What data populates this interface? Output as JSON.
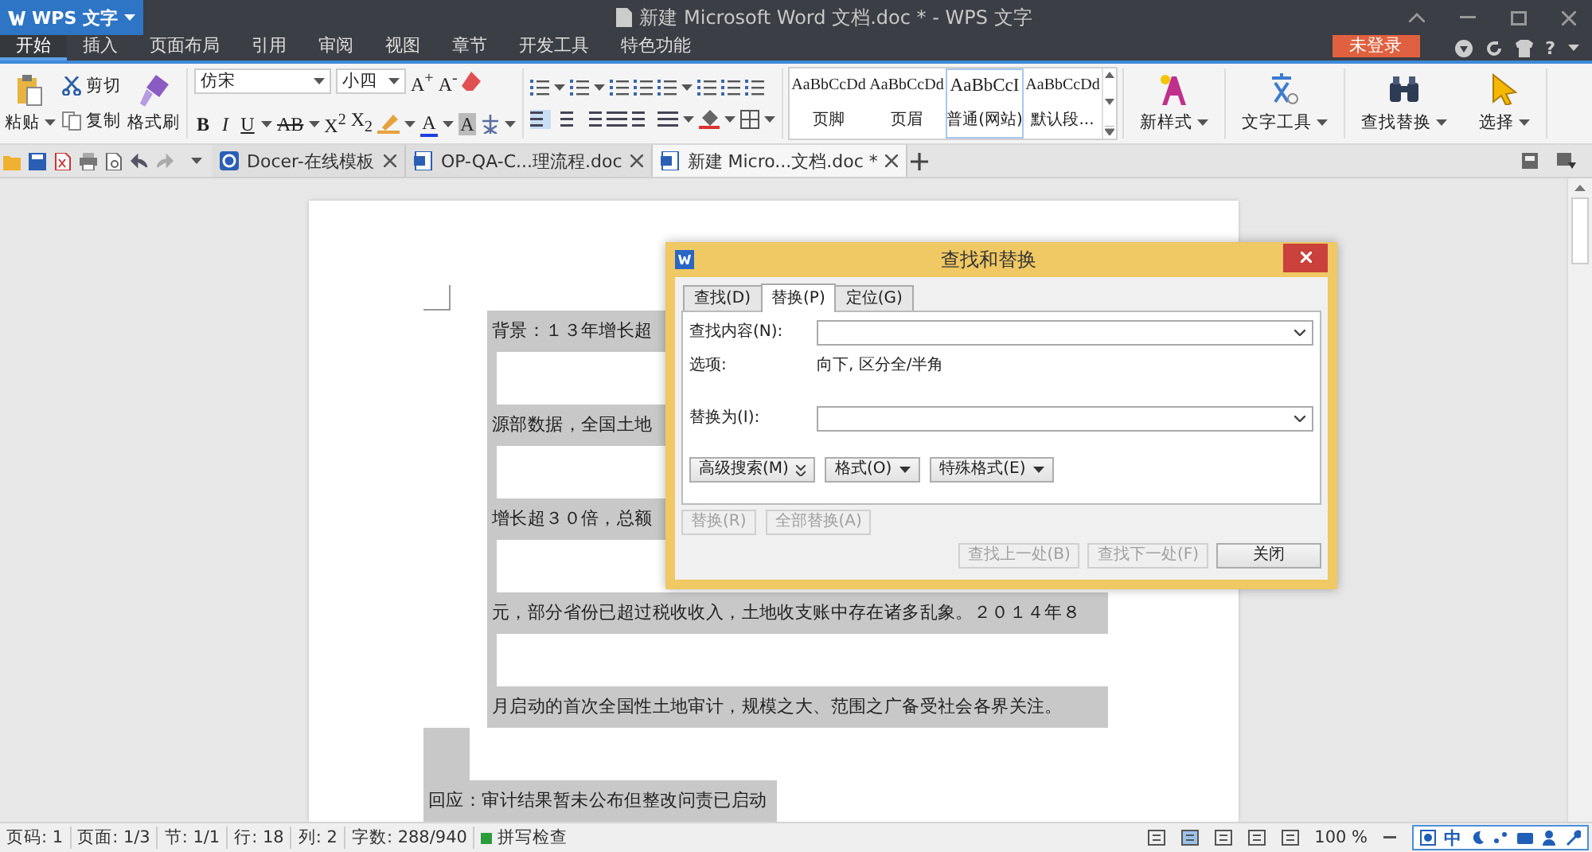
{
  "app_menu": {
    "label": "WPS 文字"
  },
  "window": {
    "title": "新建 Microsoft Word 文档.doc * - WPS 文字"
  },
  "menu_tabs": [
    {
      "label": "开始",
      "selected": true
    },
    {
      "label": "插入",
      "selected": false
    },
    {
      "label": "页面布局",
      "selected": false
    },
    {
      "label": "引用",
      "selected": false
    },
    {
      "label": "审阅",
      "selected": false
    },
    {
      "label": "视图",
      "selected": false
    },
    {
      "label": "章节",
      "selected": false
    },
    {
      "label": "开发工具",
      "selected": false
    },
    {
      "label": "特色功能",
      "selected": false
    }
  ],
  "login_button": "未登录",
  "help_button": "?",
  "ribbon": {
    "clipboard": {
      "paste": "粘贴",
      "cut": "剪切",
      "copy": "复制",
      "format_painter": "格式刷"
    },
    "font": {
      "name": "仿宋",
      "size": "小四",
      "row1": [
        "A$^{+}$",
        "A$^{-}$"
      ],
      "row2": [
        "B",
        "I",
        "U",
        "AB",
        "X$^{2}$",
        "X$_{2}$"
      ],
      "color_letters": [
        "A",
        "A"
      ]
    },
    "styles": [
      {
        "sample": "AaBbCcDd",
        "name": "页脚",
        "selected": false
      },
      {
        "sample": "AaBbCcDd",
        "name": "页眉",
        "selected": false
      },
      {
        "sample": "AaBbCcI",
        "name": "普通(网站)",
        "selected": true
      },
      {
        "sample": "AaBbCcDd",
        "name": "默认段...",
        "selected": false
      }
    ],
    "tools": [
      {
        "kind": "style",
        "label": "新样式"
      },
      {
        "kind": "text",
        "label": "文字工具"
      },
      {
        "kind": "find",
        "label": "查找替换"
      },
      {
        "kind": "select",
        "label": "选择"
      }
    ]
  },
  "doc_tabs": [
    {
      "kind": "docer",
      "label": "Docer-在线模板",
      "selected": false
    },
    {
      "kind": "doc",
      "label": "OP-QA-C...理流程.doc",
      "selected": false
    },
    {
      "kind": "doc",
      "label": "新建 Micro...文档.doc *",
      "selected": true
    }
  ],
  "document": {
    "lines": [
      {
        "kind": "body",
        "text": "背景：１３年增长超"
      },
      {
        "kind": "body",
        "text": "源部数据，全国土地"
      },
      {
        "kind": "body",
        "text": "增长超３０倍，总额"
      },
      {
        "kind": "body",
        "text": "元，部分省份已超过税收收入，土地收支账中存在诸多乱象。２０１４年８"
      },
      {
        "kind": "body",
        "text": "月启动的首次全国性土地审计，规模之大、范围之广备受社会各界关注。"
      },
      {
        "kind": "heading",
        "text": "回应：审计结果暂未公布但整改问责已启动"
      }
    ]
  },
  "dialog": {
    "title": "查找和替换",
    "tabs": [
      {
        "label": "查找(D)",
        "selected": false
      },
      {
        "label": "替换(P)",
        "selected": true
      },
      {
        "label": "定位(G)",
        "selected": false
      }
    ],
    "find_label": "查找内容(N):",
    "options_label": "选项:",
    "options_value": "向下, 区分全/半角",
    "replace_label": "替换为(I):",
    "option_buttons": [
      {
        "kind": "expand",
        "label": "高级搜索(M)"
      },
      {
        "kind": "menu",
        "label": "格式(O)"
      },
      {
        "kind": "menu",
        "label": "特殊格式(E)"
      }
    ],
    "replace_buttons": [
      {
        "label": "替换(R)",
        "disabled": true
      },
      {
        "label": "全部替换(A)",
        "disabled": true
      }
    ],
    "nav_buttons": [
      {
        "label": "查找上一处(B)",
        "disabled": true
      },
      {
        "label": "查找下一处(F)",
        "disabled": true
      },
      {
        "label": "关闭",
        "disabled": false
      }
    ]
  },
  "status_bar": {
    "items": [
      "页码: 1",
      "页面: 1/3",
      "节: 1/1",
      "行: 18",
      "列: 2",
      "字数: 288/940"
    ],
    "spell_check": "拼写检查",
    "zoom": "100 %",
    "ime_mode": "中"
  }
}
